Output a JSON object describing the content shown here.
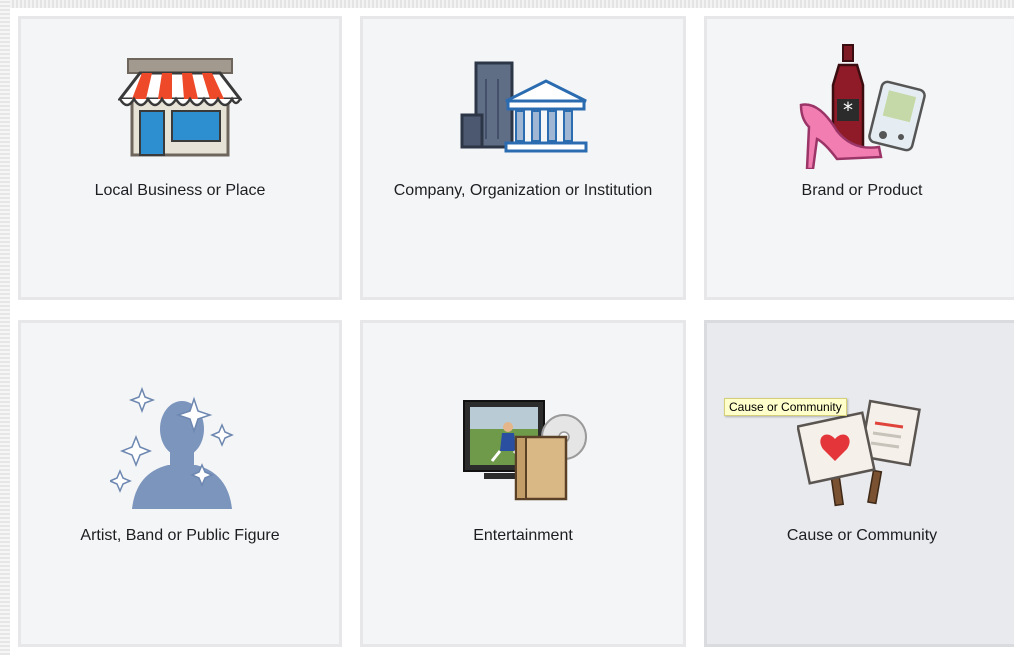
{
  "categories": [
    {
      "label": "Local Business or Place",
      "icon": "storefront-icon"
    },
    {
      "label": "Company, Organization or Institution",
      "icon": "building-icon"
    },
    {
      "label": "Brand or Product",
      "icon": "products-icon"
    },
    {
      "label": "Artist, Band or Public Figure",
      "icon": "person-silhouette-icon"
    },
    {
      "label": "Entertainment",
      "icon": "entertainment-icon"
    },
    {
      "label": "Cause or Community",
      "icon": "protest-signs-icon"
    }
  ],
  "tooltip": {
    "text": "Cause or Community"
  },
  "colors": {
    "tile_bg": "#f4f5f7",
    "tile_hover_bg": "#e9eaed",
    "tooltip_bg": "#ffffcc"
  }
}
